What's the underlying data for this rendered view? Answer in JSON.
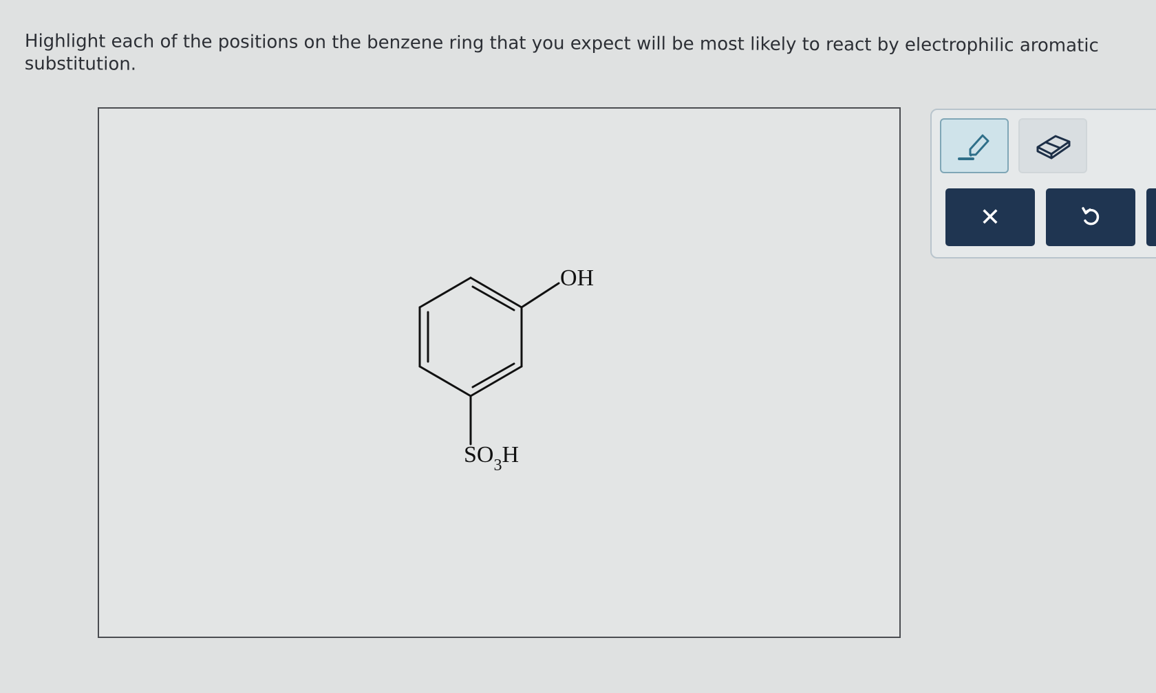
{
  "question": {
    "text": "Highlight each of the positions on the benzene ring that you expect will be most likely to react by electrophilic aromatic substitution."
  },
  "molecule": {
    "substituent_top": "OH",
    "substituent_bottom_main": "SO",
    "substituent_bottom_sub": "3",
    "substituent_bottom_end": "H"
  },
  "toolbar": {
    "highlighter_icon": "highlighter-icon",
    "eraser_icon": "eraser-icon",
    "clear_label": "✕",
    "undo_icon": "undo-icon"
  },
  "colors": {
    "accent": "#1f3551",
    "highlighter_bg": "#cfe3ea",
    "highlighter_border": "#7fa6b6"
  }
}
